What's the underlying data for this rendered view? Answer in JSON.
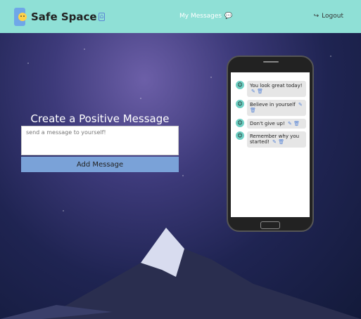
{
  "nav": {
    "brand": "Safe Space",
    "messages_label": "My Messages",
    "logout_label": "Logout"
  },
  "form": {
    "title": "Create a Positive Message",
    "placeholder": "send a message to yourself!",
    "button_label": "Add Message"
  },
  "messages": [
    {
      "text": "You look great today!"
    },
    {
      "text": "Believe in yourself"
    },
    {
      "text": "Don't give up!"
    },
    {
      "text": "Remember why you started!"
    }
  ],
  "colors": {
    "nav": "#8fe0d6",
    "button": "#7aa2d8",
    "accent": "#5a86d6"
  }
}
